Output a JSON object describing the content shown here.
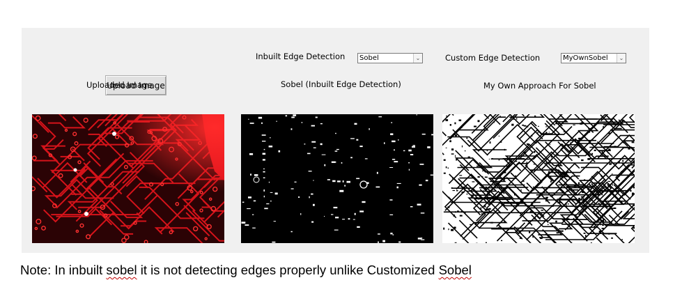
{
  "upload": {
    "button_label": "Upload Image",
    "caption": "Uploaded Image"
  },
  "inbuilt": {
    "label": "Inbuilt Edge Detection",
    "selected": "Sobel",
    "caption": "Sobel (Inbuilt Edge Detection)"
  },
  "custom": {
    "label": "Custom Edge Detection",
    "selected": "MyOwnSobel",
    "caption": "My Own Approach For Sobel"
  },
  "note": {
    "prefix": "Note: In inbuilt ",
    "word1": "sobel",
    "middle": " it is not detecting edges properly unlike Customized ",
    "word2": "Sobel"
  },
  "icons": {
    "dropdown": "chevron-down-icon"
  },
  "colors": {
    "window_bg": "#f0f0f0",
    "pcb_red": "#e0141c",
    "pcb_dark": "#3a0407"
  }
}
